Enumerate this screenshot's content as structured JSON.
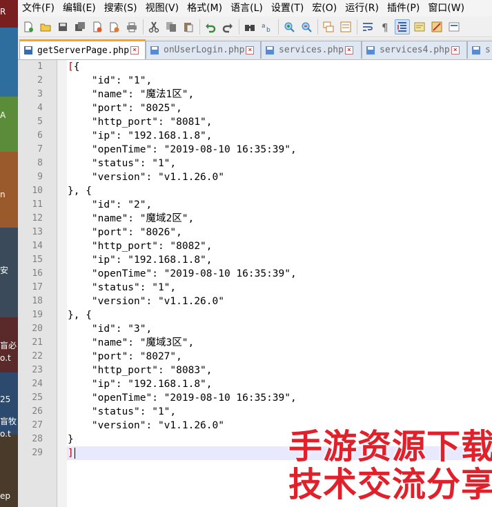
{
  "menu": [
    "文件(F)",
    "编辑(E)",
    "搜索(S)",
    "视图(V)",
    "格式(M)",
    "语言(L)",
    "设置(T)",
    "宏(O)",
    "运行(R)",
    "插件(P)",
    "窗口(W)"
  ],
  "toolbar": {
    "icons": [
      "new-file-icon",
      "open-file-icon",
      "save-icon",
      "save-all-icon",
      "close-icon",
      "close-all-icon",
      "print-icon",
      "cut-icon",
      "copy-icon",
      "paste-icon",
      "undo-icon",
      "redo-icon",
      "find-icon",
      "replace-icon",
      "zoom-in-icon",
      "zoom-out-icon",
      "sync-vertical-icon",
      "sync-horizontal-icon",
      "word-wrap-icon",
      "show-all-chars-icon",
      "indent-guide-icon",
      "doc-map-icon",
      "function-list-icon",
      "folder-workspace-icon"
    ]
  },
  "tabs": [
    {
      "label": "getServerPage.php",
      "active": true
    },
    {
      "label": "onUserLogin.php",
      "active": false
    },
    {
      "label": "services.php",
      "active": false
    },
    {
      "label": "services4.php",
      "active": false
    },
    {
      "label": "s",
      "active": false
    }
  ],
  "editor": {
    "lines": [
      "[{",
      "    \"id\": \"1\",",
      "    \"name\": \"魔法1区\",",
      "    \"port\": \"8025\",",
      "    \"http_port\": \"8081\",",
      "    \"ip\": \"192.168.1.8\",",
      "    \"openTime\": \"2019-08-10 16:35:39\",",
      "    \"status\": \"1\",",
      "    \"version\": \"v1.1.26.0\"",
      "}, {",
      "    \"id\": \"2\",",
      "    \"name\": \"魔域2区\",",
      "    \"port\": \"8026\",",
      "    \"http_port\": \"8082\",",
      "    \"ip\": \"192.168.1.8\",",
      "    \"openTime\": \"2019-08-10 16:35:39\",",
      "    \"status\": \"1\",",
      "    \"version\": \"v1.1.26.0\"",
      "}, {",
      "    \"id\": \"3\",",
      "    \"name\": \"魔域3区\",",
      "    \"port\": \"8027\",",
      "    \"http_port\": \"8083\",",
      "    \"ip\": \"192.168.1.8\",",
      "    \"openTime\": \"2019-08-10 16:35:39\",",
      "    \"status\": \"1\",",
      "    \"version\": \"v1.1.26.0\"",
      "}",
      "]"
    ],
    "current_line": 29
  },
  "watermark": {
    "line1": "手游资源下载",
    "line2": "技术交流分享"
  },
  "desktop_strip": {
    "texts": [
      "R",
      "A",
      "n",
      "安",
      "盲必",
      "o.t",
      "25",
      "盲牧",
      "o.t",
      "ep"
    ]
  },
  "colors": {
    "bracket": "#c00000",
    "active_tab_accent": "#f5a623",
    "current_line": "#e8e8ff",
    "watermark": "#e0202a"
  }
}
